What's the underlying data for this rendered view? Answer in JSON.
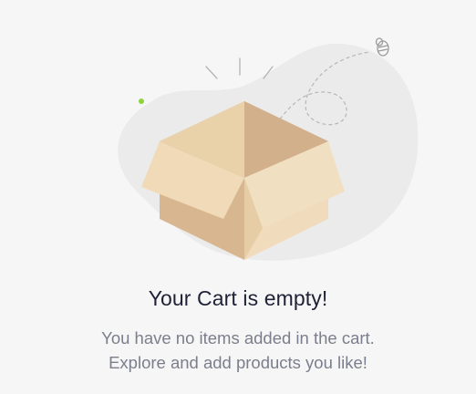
{
  "empty_state": {
    "title": "Your Cart is empty!",
    "message_line_1": "You have no items added in the cart.",
    "message_line_2": "Explore and add products you like!"
  },
  "illustration": {
    "icon": "empty-box-icon",
    "colors": {
      "blob": "#e8e8e8",
      "box_light": "#f0dcbc",
      "box_mid": "#e6cda6",
      "box_dark": "#d4b18c",
      "accent_dot": "#8bd43a",
      "lines": "#b9b9b9"
    }
  }
}
